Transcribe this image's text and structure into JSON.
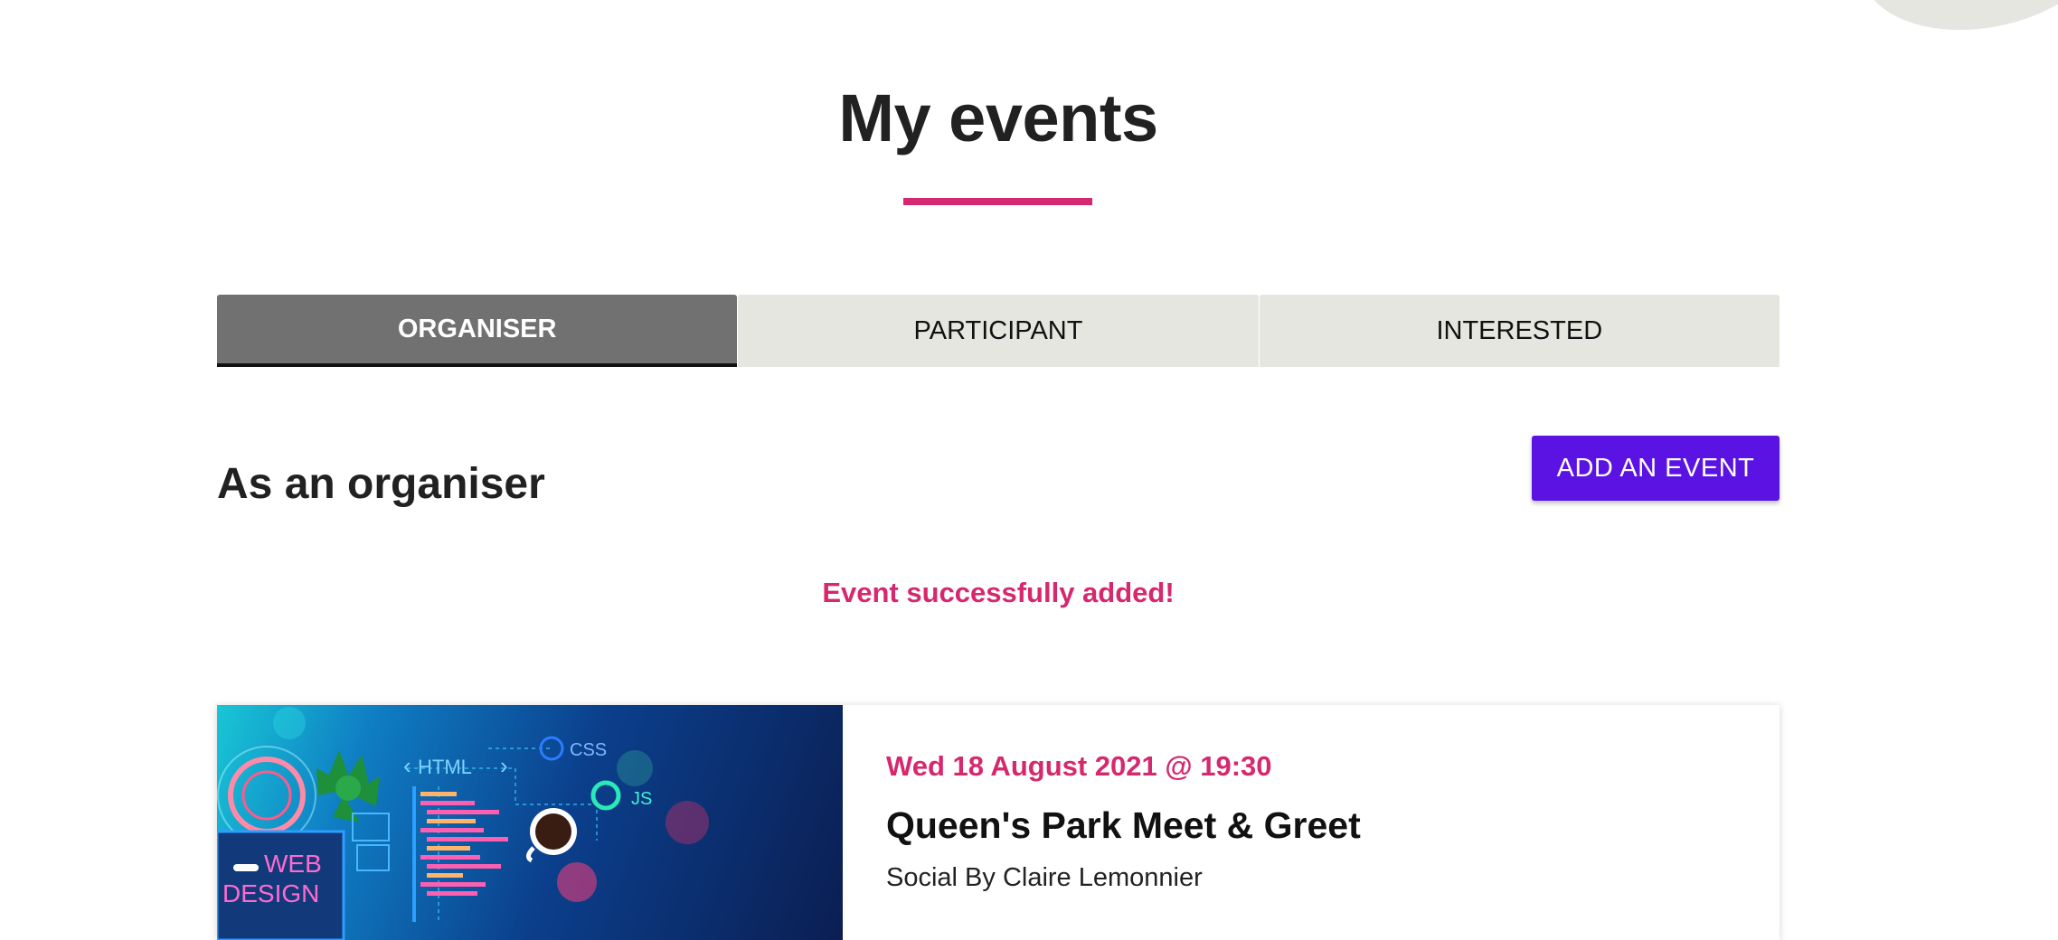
{
  "page": {
    "title": "My events"
  },
  "tabs": [
    {
      "label": "ORGANISER",
      "active": true
    },
    {
      "label": "PARTICIPANT",
      "active": false
    },
    {
      "label": "INTERESTED",
      "active": false
    }
  ],
  "section": {
    "title": "As an organiser",
    "add_button_label": "ADD AN EVENT",
    "success_message": "Event successfully added!"
  },
  "events": [
    {
      "date": "Wed 18 August 2021 @ 19:30",
      "name": "Queen's Park Meet & Greet",
      "meta": "Social By Claire Lemonnier",
      "image": {
        "html_label": "HTML",
        "css_label": "CSS",
        "js_label": "JS",
        "web_label": "WEB",
        "design_label": "DESIGN"
      }
    }
  ],
  "colors": {
    "accent": "#d6286e",
    "primary_button": "#5a13e3",
    "tab_active": "#717171",
    "tab_inactive": "#e6e6e1"
  }
}
